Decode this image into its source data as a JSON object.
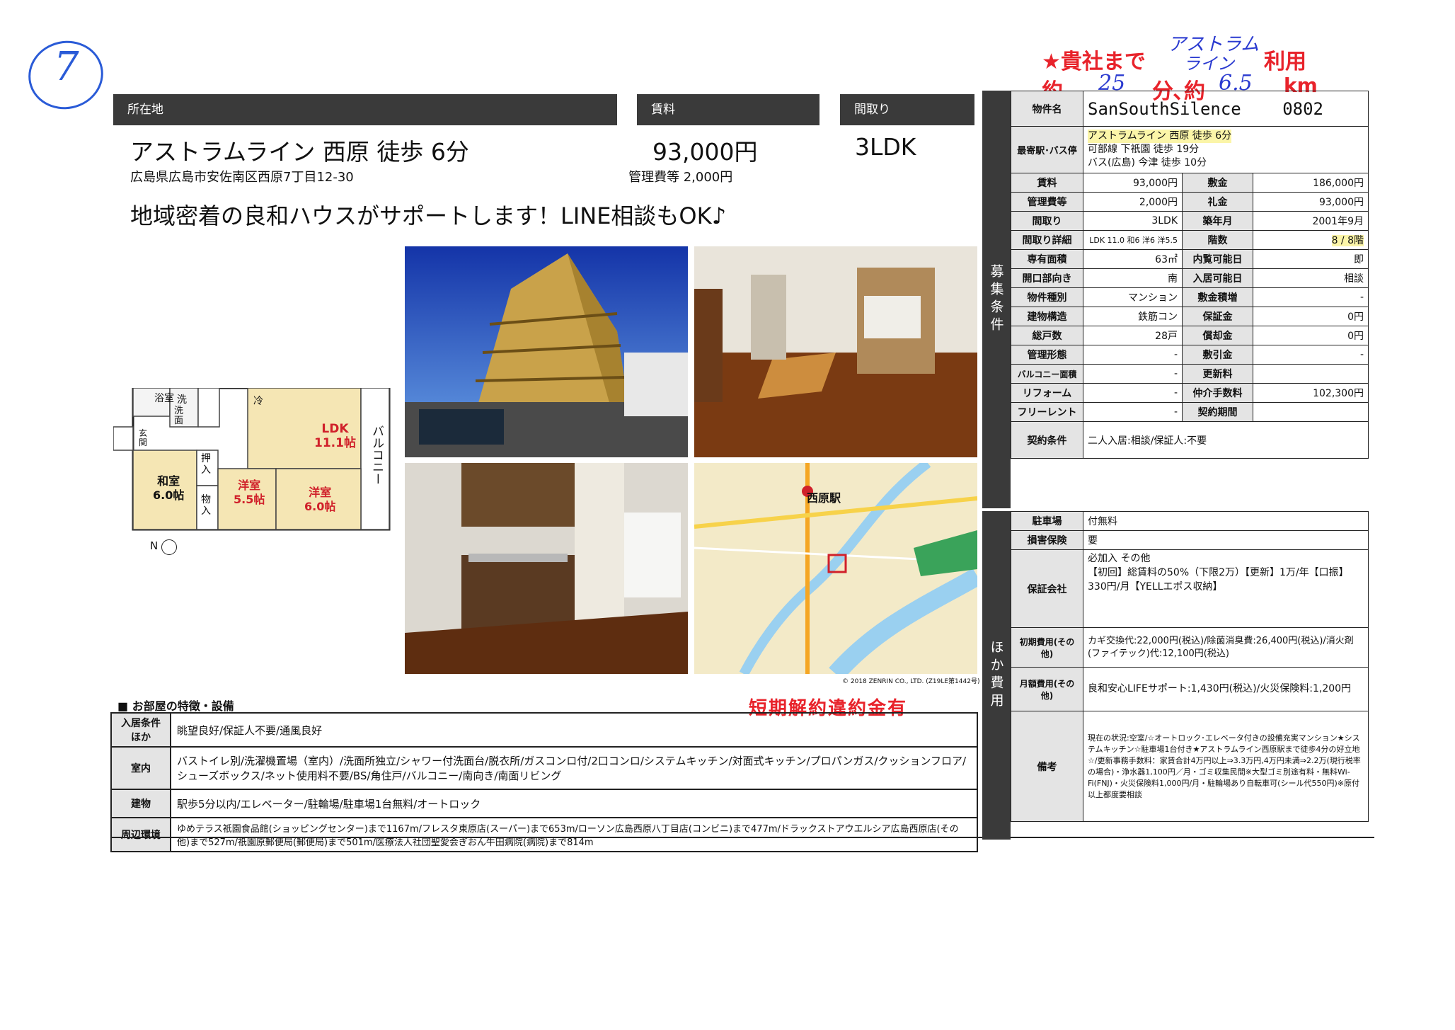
{
  "handwriting": {
    "circled_number": "7",
    "note_line1_prefix": "★貴社まで",
    "note_line1_blue_top": "アストラム",
    "note_line1_blue_bottom": "ライン",
    "note_line1_suffix": "利用",
    "note_line2_a": "約",
    "note_line2_b": "25",
    "note_line2_c": "分､約",
    "note_line2_d": "6.5",
    "note_line2_e": "km"
  },
  "header": {
    "location_label": "所在地",
    "rent_label": "賃料",
    "layout_label": "間取り",
    "access": "アストラムライン 西原 徒歩 6分",
    "rent": "93,000円",
    "layout": "3LDK",
    "address": "広島県広島市安佐南区西原7丁目12-30",
    "fee": "管理費等 2,000円",
    "slogan": "地域密着の良和ハウスがサポートします！LINE相談もOK♪"
  },
  "floorplan": {
    "bath": "浴室",
    "wash": "洗",
    "washroom": "洗\n面",
    "fridge": "冷",
    "ldk": "LDK\n11.1帖",
    "entrance": "玄\n関",
    "balcony": "バルコニー",
    "japanese_room": "和室\n6.0帖",
    "closet1": "押\n入",
    "closet2": "物\n入",
    "western1": "洋室\n5.5帖",
    "western2": "洋室\n6.0帖",
    "north": "N"
  },
  "map": {
    "station": "西原駅",
    "copyright": "© 2018 ZENRIN CO., LTD. (Z19LE第1442号)"
  },
  "features": {
    "section_title": "■ お部屋の特徴・設備",
    "stamp": "短期解約違約金有",
    "rows": [
      {
        "label": "入居条件ほか",
        "value": "眺望良好/保証人不要/通風良好"
      },
      {
        "label": "室内",
        "value": "バストイレ別/洗濯機置場（室内）/洗面所独立/シャワー付洗面台/脱衣所/ガスコンロ付/2口コンロ/システムキッチン/対面式キッチン/プロパンガス/クッションフロア/シューズボックス/ネット使用料不要/BS/角住戸/バルコニー/南向き/南面リビング"
      },
      {
        "label": "建物",
        "value": "駅歩5分以内/エレベーター/駐輪場/駐車場1台無料/オートロック"
      },
      {
        "label": "周辺環境",
        "value": "ゆめテラス祇園食品館(ショッピングセンター)まで1167m/フレスタ東原店(スーパー)まで653m/ローソン広島西原八丁目店(コンビニ)まで477m/ドラックストアウエルシア広島西原店(その他)まで527m/祇園原郵便局(郵便局)まで501m/医療法人社団聖愛会ぎおん牛田病院(病院)まで814m"
      }
    ]
  },
  "spec": {
    "side_label": "募集条件",
    "name_label": "物件名",
    "name": "SanSouthSilence",
    "room": "0802",
    "station_label": "最寄駅･バス停",
    "station1": "アストラムライン 西原 徒歩 6分",
    "station2": "可部線 下祇園 徒歩 19分",
    "station3": "バス(広島) 今津 徒歩 10分",
    "rows": [
      {
        "l1": "賃料",
        "v1": "93,000円",
        "l2": "敷金",
        "v2": "186,000円"
      },
      {
        "l1": "管理費等",
        "v1": "2,000円",
        "l2": "礼金",
        "v2": "93,000円"
      },
      {
        "l1": "間取り",
        "v1": "3LDK",
        "l2": "築年月",
        "v2": "2001年9月"
      },
      {
        "l1": "間取り詳細",
        "v1": "LDK 11.0 和6 洋6 洋5.5",
        "l2": "階数",
        "v2": "8 / 8階"
      },
      {
        "l1": "専有面積",
        "v1": "63㎡",
        "l2": "内覧可能日",
        "v2": "即"
      },
      {
        "l1": "開口部向き",
        "v1": "南",
        "l2": "入居可能日",
        "v2": "相談"
      },
      {
        "l1": "物件種別",
        "v1": "マンション",
        "l2": "敷金積増",
        "v2": "-"
      },
      {
        "l1": "建物構造",
        "v1": "鉄筋コン",
        "l2": "保証金",
        "v2": "0円"
      },
      {
        "l1": "総戸数",
        "v1": "28戸",
        "l2": "償却金",
        "v2": "0円"
      },
      {
        "l1": "管理形態",
        "v1": "-",
        "l2": "敷引金",
        "v2": "-"
      },
      {
        "l1": "バルコニー面積",
        "v1": "-",
        "l2": "更新料",
        "v2": ""
      },
      {
        "l1": "リフォーム",
        "v1": "-",
        "l2": "仲介手数料",
        "v2": "102,300円"
      },
      {
        "l1": "フリーレント",
        "v1": "-",
        "l2": "契約期間",
        "v2": ""
      }
    ],
    "contract_label": "契約条件",
    "contract": "二人入居:相談/保証人:不要"
  },
  "other": {
    "side_label": "ほか費用",
    "parking_label": "駐車場",
    "parking": "付無料",
    "insurance_label": "損害保険",
    "insurance": "要",
    "guarantor_label": "保証会社",
    "guarantor": "必加入 その他\n【初回】総賃料の50%（下限2万）【更新】1万/年【口振】330円/月【YELLエポス収納】",
    "initial_label": "初期費用(その他)",
    "initial": "カギ交換代:22,000円(税込)/除菌消臭費:26,400円(税込)/消火剤(ファイテック)代:12,100円(税込)",
    "monthly_label": "月額費用(その他)",
    "monthly": "良和安心LIFEサポート:1,430円(税込)/火災保険料:1,200円",
    "remarks_label": "備考",
    "remarks": "現在の状況:空室/☆オートロック･エレベータ付きの設備充実マンション★システムキッチン☆駐車場1台付き★アストラムライン西原駅まで徒歩4分の好立地☆/更新事務手数料：家賃合計4万円以上⇒3.3万円,4万円未満⇒2.2万(現行税率の場合)・浄水器1,100円／月・ゴミ収集民間※大型ゴミ別途有料・無料Wi-Fi(FNJ)・火災保険料1,000円/月・駐輪場あり自転車可(シール代550円)※原付以上都度要相談"
  }
}
